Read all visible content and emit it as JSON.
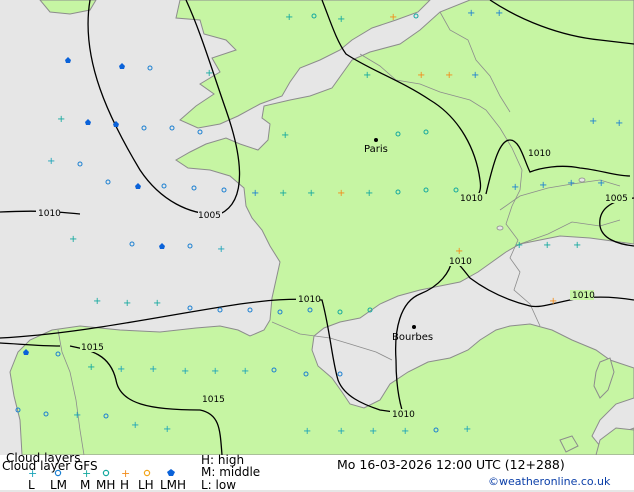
{
  "colors": {
    "sea": "#e6e6e6",
    "land": "#c6f5a3",
    "coast": "#8c8c8c",
    "isobar": "#000000",
    "low": "#1aa3b8",
    "lm": "#1a7fd1",
    "middle": "#13a89e",
    "mh": "#13a89e",
    "high": "#f28c1a",
    "lh": "#f2a51a",
    "lmh": "#0a62d9"
  },
  "isobar_labels": [
    "1010",
    "1005",
    "1010",
    "1010",
    "1010",
    "1005",
    "1010",
    "1010",
    "1015",
    "1015",
    "1010"
  ],
  "cities": [
    {
      "name": "Paris"
    },
    {
      "name": "Bourbes"
    }
  ],
  "footer": {
    "title_line": "Cloud layers",
    "subtitle_line": "Cloud layer GFS",
    "legend_labels": [
      "L",
      "LM",
      "M",
      "MH",
      "H",
      "LH",
      "LMH"
    ],
    "legend_icons": [
      "plus-low",
      "circle-lm",
      "plus-middle",
      "circle-mh",
      "plus-high",
      "circle-lh",
      "pentagon-lmh"
    ],
    "key": {
      "high": "H: high",
      "middle": "M: middle",
      "low": "L: low"
    },
    "datetime": "Mo 16-03-2026 12:00 UTC (12+288)",
    "credit": "©weatheronline.co.uk"
  }
}
